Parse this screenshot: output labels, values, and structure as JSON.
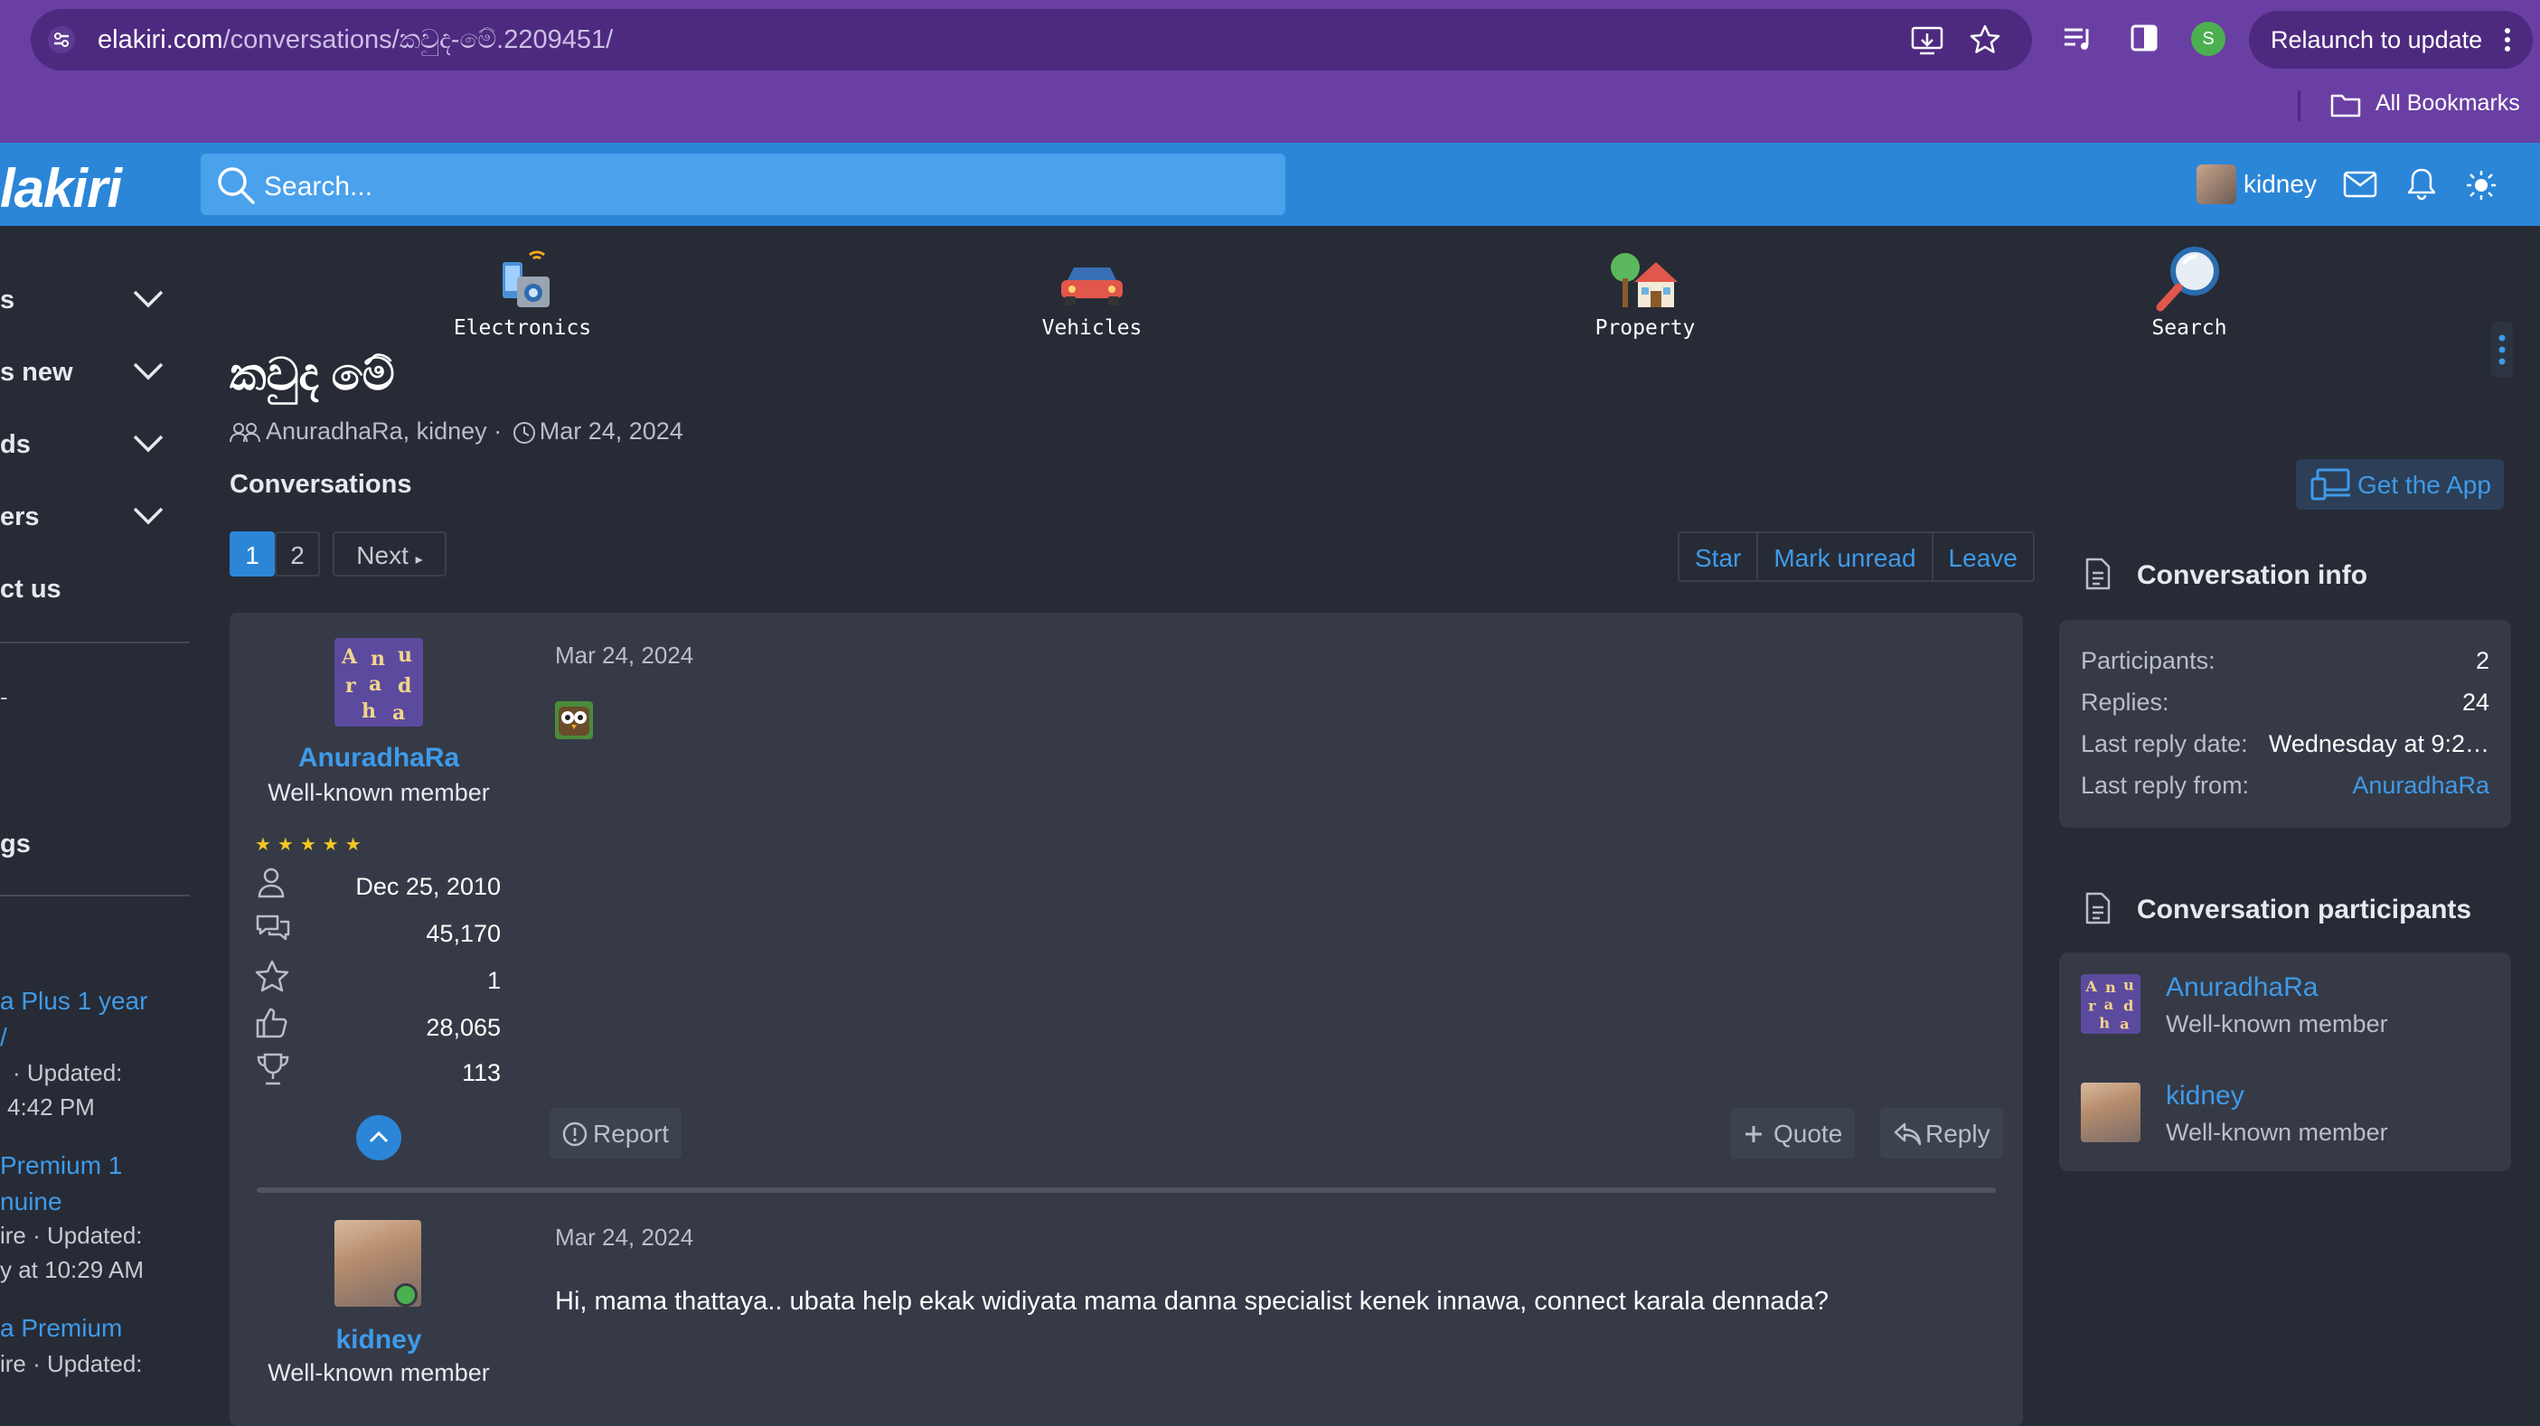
{
  "browser": {
    "url_host": "elakiri.com",
    "url_path": "/conversations/කවුද-මේ.2209451/",
    "relaunch_label": "Relaunch to update",
    "profile_initial": "S",
    "bookmarks_label": "All Bookmarks"
  },
  "header": {
    "logo_text": "lakiri",
    "search_placeholder": "Search...",
    "username": "kidney"
  },
  "sidebar": {
    "items": [
      {
        "label": "s"
      },
      {
        "label": "s new"
      },
      {
        "label": "ds"
      },
      {
        "label": "ers"
      },
      {
        "label": "ct us"
      }
    ],
    "dash": "-",
    "section": "gs",
    "threads": [
      {
        "line1": "a Plus 1 year",
        "line2": "/",
        "meta1": "· Updated:",
        "meta2": "4:42 PM"
      },
      {
        "line1": "Premium 1",
        "line2": "nuine",
        "meta1": "ire · Updated:",
        "meta2": "y at 10:29 AM"
      },
      {
        "line1": "a Premium",
        "meta1": "ire · Updated:"
      }
    ]
  },
  "categories": [
    {
      "label": "Electronics"
    },
    {
      "label": "Vehicles"
    },
    {
      "label": "Property"
    },
    {
      "label": "Search"
    }
  ],
  "conversation": {
    "title": "කවුද මේ",
    "participants": "AnuradhaRa, kidney",
    "sep": "·",
    "date": "Mar 24, 2024",
    "section_label": "Conversations",
    "pages": [
      "1",
      "2"
    ],
    "next_label": "Next",
    "actions": [
      "Star",
      "Mark unread",
      "Leave"
    ]
  },
  "messages": [
    {
      "username": "AnuradhaRa",
      "user_title": "Well-known member",
      "avatar_letters": [
        "A",
        "n",
        "u",
        "r",
        "a",
        "d",
        "h",
        "a"
      ],
      "stars": "★★★★★",
      "joined": "Dec 25, 2010",
      "messages": "45,170",
      "points": "1",
      "reactions": "28,065",
      "trophies": "113",
      "date": "Mar 24, 2024",
      "report_label": "Report",
      "quote_label": "Quote",
      "reply_label": "Reply"
    },
    {
      "username": "kidney",
      "user_title": "Well-known member",
      "date": "Mar 24, 2024",
      "body": "Hi, mama thattaya.. ubata help ekak widiyata mama danna specialist kenek innawa, connect karala dennada?"
    }
  ],
  "right_sidebar": {
    "get_app_label": "Get the App",
    "info_title": "Conversation info",
    "info": [
      {
        "label": "Participants:",
        "value": "2"
      },
      {
        "label": "Replies:",
        "value": "24"
      },
      {
        "label": "Last reply date:",
        "value": "Wednesday at 9:2…"
      },
      {
        "label": "Last reply from:",
        "value": "AnuradhaRa"
      }
    ],
    "participants_title": "Conversation participants",
    "participants": [
      {
        "name": "AnuradhaRa",
        "title": "Well-known member"
      },
      {
        "name": "kidney",
        "title": "Well-known member"
      }
    ]
  },
  "colors": {
    "browser_chrome": "#6a3fa3",
    "site_header": "#2b86d8",
    "background": "#272b35",
    "link": "#3f9ae8",
    "star": "#f3c623"
  }
}
